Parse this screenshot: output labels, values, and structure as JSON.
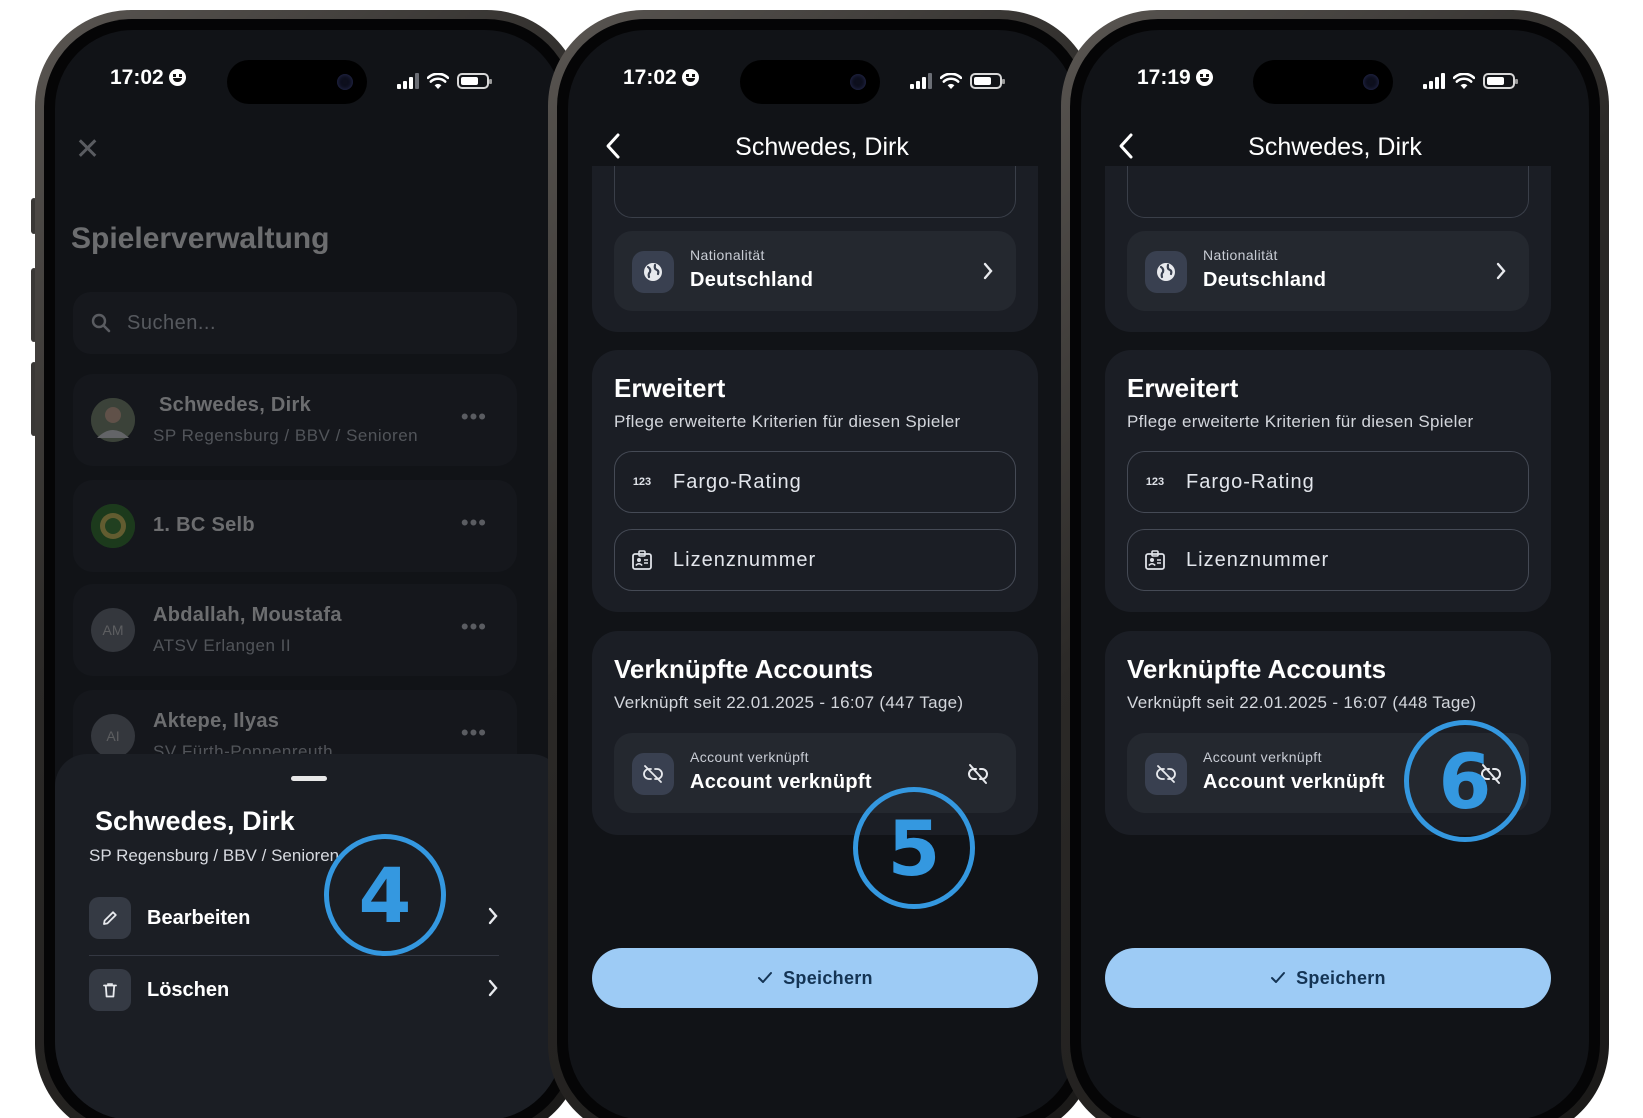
{
  "colors": {
    "background": "#111317",
    "card": "#1b1e25",
    "tile": "#24282f",
    "accent_button": "#9dcbf5",
    "annotation": "#3498e0"
  },
  "screen1": {
    "time": "17:02",
    "title": "Spielerverwaltung",
    "search_placeholder": "Suchen...",
    "players": [
      {
        "name": "Schwedes, Dirk",
        "subtitle": "SP Regensburg / BBV / Senioren",
        "avatar": "photo"
      },
      {
        "name": "1. BC Selb",
        "subtitle": "",
        "avatar": "club-logo"
      },
      {
        "name": "Abdallah, Moustafa",
        "subtitle": "ATSV Erlangen II",
        "avatar": "AM"
      },
      {
        "name": "Aktepe, Ilyas",
        "subtitle": "SV Fürth-Poppenreuth",
        "avatar": "AI"
      }
    ],
    "sheet": {
      "name": "Schwedes, Dirk",
      "subtitle": "SP Regensburg / BBV / Senioren",
      "actions": [
        {
          "label": "Bearbeiten",
          "icon": "pencil-icon"
        },
        {
          "label": "Löschen",
          "icon": "trash-icon"
        }
      ]
    },
    "step_badge": "4"
  },
  "screen2": {
    "time": "17:02",
    "title": "Schwedes, Dirk",
    "nationality_caption": "Nationalität",
    "nationality_value": "Deutschland",
    "advanced_title": "Erweitert",
    "advanced_subtitle": "Pflege erweiterte Kriterien für diesen Spieler",
    "fargo_placeholder": "Fargo-Rating",
    "fargo_icon_text": "123",
    "license_placeholder": "Lizenznummer",
    "linked_title": "Verknüpfte Accounts",
    "linked_subtitle": "Verknüpft seit 22.01.2025 - 16:07 (447 Tage)",
    "account_caption": "Account verknüpft",
    "account_value": "Account verknüpft",
    "save_label": "Speichern",
    "step_badge": "5"
  },
  "screen3": {
    "time": "17:19",
    "title": "Schwedes, Dirk",
    "nationality_caption": "Nationalität",
    "nationality_value": "Deutschland",
    "advanced_title": "Erweitert",
    "advanced_subtitle": "Pflege erweiterte Kriterien für diesen Spieler",
    "fargo_placeholder": "Fargo-Rating",
    "fargo_icon_text": "123",
    "license_placeholder": "Lizenznummer",
    "linked_title": "Verknüpfte Accounts",
    "linked_subtitle": "Verknüpft seit 22.01.2025 - 16:07 (448 Tage)",
    "account_caption": "Account verknüpft",
    "account_value": "Account verknüpft",
    "save_label": "Speichern",
    "step_badge": "6"
  }
}
